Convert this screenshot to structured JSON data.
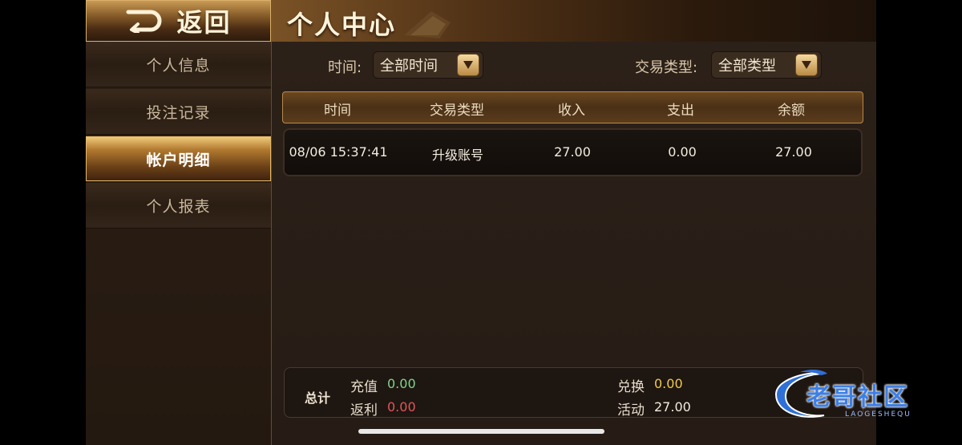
{
  "back": {
    "label": "返回"
  },
  "header": {
    "title": "个人中心"
  },
  "sidebar": {
    "items": [
      {
        "label": "个人信息"
      },
      {
        "label": "投注记录"
      },
      {
        "label": "帐户明细"
      },
      {
        "label": "个人报表"
      }
    ]
  },
  "filters": {
    "time": {
      "label": "时间:",
      "value": "全部时间"
    },
    "type": {
      "label": "交易类型:",
      "value": "全部类型"
    }
  },
  "table": {
    "columns": [
      "时间",
      "交易类型",
      "收入",
      "支出",
      "余额"
    ],
    "rows": [
      [
        "08/06 15:37:41",
        "升级账号",
        "27.00",
        "0.00",
        "27.00"
      ]
    ]
  },
  "summary": {
    "title": "总计",
    "recharge": {
      "label": "充值",
      "value": "0.00",
      "color": "#7fd48a"
    },
    "rebate": {
      "label": "返利",
      "value": "0.00",
      "color": "#e0565b"
    },
    "exchange": {
      "label": "兑换",
      "value": "0.00",
      "color": "#f0c94a"
    },
    "activity": {
      "label": "活动",
      "value": "27.00",
      "color": "#f2ecdf"
    }
  },
  "watermark": {
    "text": "老哥社区",
    "sub": "LAOGESHEQU"
  }
}
